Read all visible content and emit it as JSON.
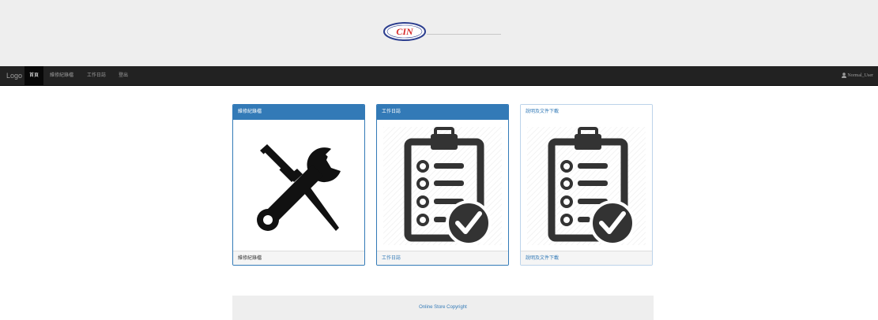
{
  "header": {
    "logo_text": "CIN"
  },
  "navbar": {
    "brand": "Logo",
    "items": [
      {
        "label": "首頁",
        "active": true
      },
      {
        "label": "維修紀錄檔",
        "active": false
      },
      {
        "label": "工作日誌",
        "active": false
      },
      {
        "label": "登出",
        "active": false
      }
    ],
    "user": "Normal_User"
  },
  "cards": [
    {
      "title": "維修紀錄檔",
      "footer": "維修紀錄檔",
      "icon": "tools-icon"
    },
    {
      "title": "工作日誌",
      "footer": "工作日誌",
      "icon": "clipboard-check-icon"
    },
    {
      "title": "說明及文件下載",
      "footer": "說明及文件下載",
      "icon": "clipboard-check-icon"
    }
  ],
  "footer": {
    "copyright": "Online Store Copyright"
  },
  "colors": {
    "primary": "#337ab7",
    "navbar_bg": "#222222",
    "header_bg": "#eeeeee",
    "logo_red": "#d62a2a",
    "logo_blue": "#2c3e8f"
  }
}
